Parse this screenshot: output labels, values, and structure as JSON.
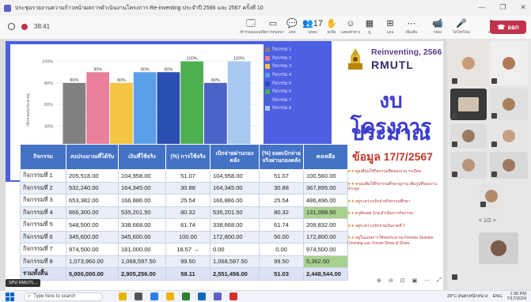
{
  "window": {
    "title": "ประชุมรายงานความก้าวหน้าผลการดำเนินงานโครงการ Re-inventing ประจำปี 2566 และ 2567 ครั้งที่ 10",
    "controls": [
      "—",
      "❐",
      "✕"
    ]
  },
  "toolbar": {
    "timer": "38:41",
    "buttons": [
      {
        "icon": "🗔",
        "label": "เข้าร่วมมุมมอง"
      },
      {
        "icon": "▭",
        "label": "ปิดการสนทนา"
      },
      {
        "icon": "💬",
        "label": "แชท"
      },
      {
        "icon": "👥",
        "label": "บุคคล",
        "count": "17"
      },
      {
        "icon": "✋",
        "label": "ยกมือ"
      },
      {
        "icon": "☺",
        "label": "แสดงท่าทาง"
      },
      {
        "icon": "▦",
        "label": "ดู"
      },
      {
        "icon": "⊞",
        "label": "แอป"
      },
      {
        "icon": "⋯",
        "label": "เพิ่มเติม"
      },
      {
        "icon": "📹",
        "label": "กล้อง"
      },
      {
        "icon": "🎤",
        "label": "ไมโครโฟน"
      },
      {
        "icon": "⬆",
        "label": "แชร์"
      }
    ],
    "leave_label": "ออก"
  },
  "slide": {
    "brand": "Reinventing, 2566",
    "org": "RMUTL",
    "heading_line1": "งบประมาณ",
    "heading_line2": "โครงการ",
    "date_title": "ข้อมูล 17/7/2567",
    "notes": [
      "ดูมเดือนใช้กิจกรรมชื่อของงาน ระเบียน",
      "ครุณเพิ่มใช้กิจกรรมศึกษาดูงาน เพิ่มรูปที่ของงานประมูล",
      "อยู่ระหว่างเบิกจ่ายกิจกรรมศึกษา",
      "ครูคิดเพย 3กล.ดำเนินการกิจกรรม",
      "อยู่ระหว่างเบิกจ่ายเงินงวดที่ 2",
      "อยู่ในแผนการใช้งบประมาณ Forrsou Session Cicening และ Forum Show & Share"
    ]
  },
  "chart_data": {
    "type": "bar",
    "categories": [
      "กิจกรรม 1",
      "กิจกรรม 2",
      "กิจกรรม 3",
      "กิจกรรม 4",
      "กิจกรรม 5",
      "กิจกรรม 6",
      "กิจกรรม 7",
      "กิจกรรม 8"
    ],
    "values": [
      80,
      90,
      80,
      90,
      90,
      100,
      80,
      100
    ],
    "value_labels": [
      "80%",
      "90%",
      "80%",
      "90%",
      "90%",
      "100%",
      "80%",
      "100%"
    ],
    "colors": [
      "#808080",
      "#e97f9a",
      "#f4c542",
      "#5aa0e8",
      "#2a4fb3",
      "#4caf50",
      "#4a63c8",
      "#a9c8ef"
    ],
    "ylabel": "เบิกจ่ายงบประมาณ",
    "yticks": [
      "0%",
      "20%",
      "40%",
      "60%",
      "80%",
      "100%"
    ],
    "ylim": [
      0,
      110
    ],
    "legend": "right",
    "grid": true
  },
  "table": {
    "headers": [
      "กิจกรรม",
      "งบประมาณที่ได้รับ",
      "เงินที่ใช้จริง",
      "(%) การใช้จริง",
      "เบิกจ่ายผ่านกองคลัง",
      "(%) ยอดเบิกจ่ายจริงผ่านกองคลัง",
      "คงเหลือ"
    ],
    "rows": [
      [
        "กิจกรรมที่ 1",
        "205,518.00",
        "104,958.00",
        "51.07",
        "104,958.00",
        "51.07",
        "100,560.00"
      ],
      [
        "กิจกรรมที่ 2",
        "532,240.00",
        "164,345.00",
        "30.88",
        "164,345.00",
        "30.88",
        "367,895.00"
      ],
      [
        "กิจกรรมที่ 3",
        "653,382.00",
        "166,886.00",
        "25.54",
        "166,886.00",
        "25.54",
        "486,496.00"
      ],
      [
        "กิจกรรมที่ 4",
        "666,300.00",
        "535,201.50",
        "80.32",
        "535,201.50",
        "80.32",
        "131,098.50"
      ],
      [
        "กิจกรรมที่ 5",
        "548,500.00",
        "338,668.00",
        "61.74",
        "338,668.00",
        "61.74",
        "209,832.00"
      ],
      [
        "กิจกรรมที่ 6",
        "345,600.00",
        "345,600.00",
        "100.00",
        "172,800.00",
        "50.00",
        "172,800.00"
      ],
      [
        "กิจกรรมที่ 7",
        "974,500.00",
        "181,000.00",
        "18.57",
        "0.00",
        "0.00",
        "974,500.00"
      ],
      [
        "กิจกรรมที่ 8",
        "1,073,960.00",
        "1,068,597.50",
        "99.50",
        "1,068,597.50",
        "99.50",
        "5,362.50"
      ],
      [
        "รวมทั้งสิ้น",
        "5,000,000.00",
        "2,905,256.00",
        "58.11",
        "2,551,456.00",
        "51.03",
        "2,448,544.00"
      ]
    ],
    "row7_arrow": "→"
  },
  "presenter": {
    "name": "SPU RMUTL..."
  },
  "stage_controls": [
    "⊕",
    "⊖",
    "⊡",
    "▣",
    "⋯",
    "⤢"
  ],
  "sidebar": {
    "pager": "< 1/2 >"
  },
  "taskbar": {
    "search_placeholder": "Type here to search",
    "weather": "28°C ฝนตกหนักหน่วง",
    "lang": "ENG",
    "time": "1:36 PM",
    "date": "7/17/2024"
  }
}
